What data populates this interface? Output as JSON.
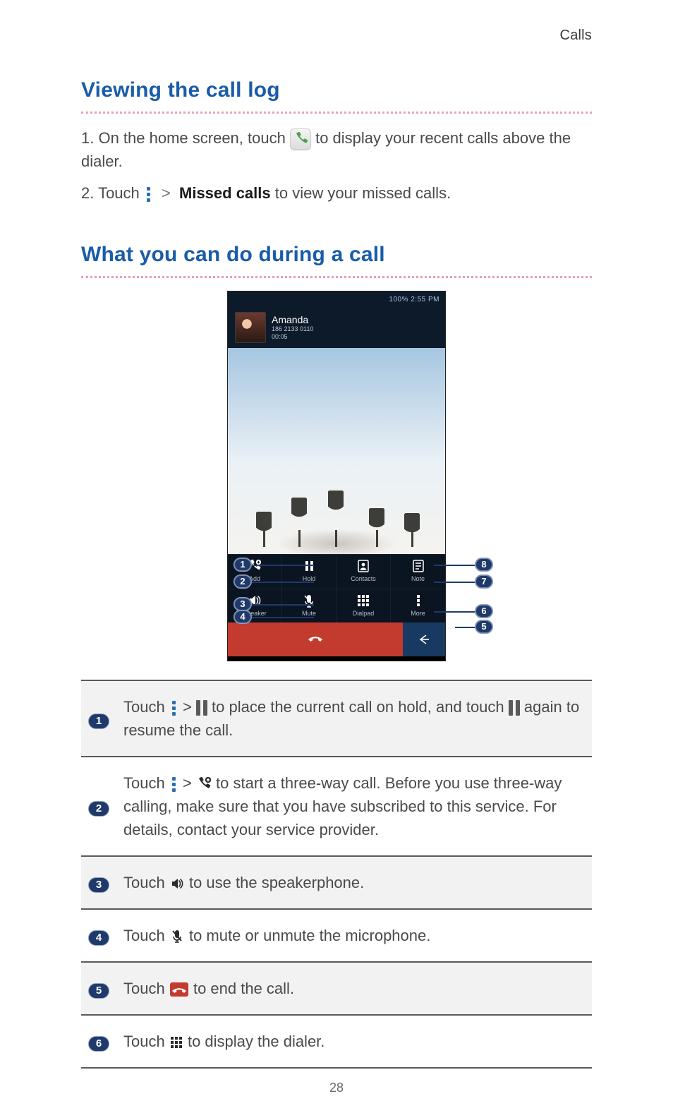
{
  "running_head": "Calls",
  "sections": {
    "viewing": {
      "title": "Viewing the call log",
      "step1_prefix": "1. On the home screen, touch ",
      "step1_suffix": " to display your recent calls above the dialer.",
      "step2_prefix": "2. Touch ",
      "step2_gt": ">",
      "step2_bold": "Missed calls",
      "step2_suffix": " to view your missed calls."
    },
    "during": {
      "title": "What you can do during a call"
    }
  },
  "phone": {
    "status_right": "100%  2:55 PM",
    "caller_name": "Amanda",
    "caller_number": "186 2133 0110",
    "elapsed": "00:05",
    "row1": [
      {
        "icon": "add-call",
        "label": "Add"
      },
      {
        "icon": "hold",
        "label": "Hold"
      },
      {
        "icon": "contacts",
        "label": "Contacts"
      },
      {
        "icon": "note",
        "label": "Note"
      }
    ],
    "row2": [
      {
        "icon": "speaker",
        "label": "Speaker"
      },
      {
        "icon": "mute",
        "label": "Mute"
      },
      {
        "icon": "dialpad",
        "label": "Dialpad"
      },
      {
        "icon": "more",
        "label": "More"
      }
    ]
  },
  "callouts_left": [
    "1",
    "2",
    "3",
    "4"
  ],
  "callouts_right": [
    "8",
    "7",
    "6",
    "5"
  ],
  "table": {
    "rows": [
      {
        "num": "1",
        "alt": true,
        "parts": {
          "p1": "Touch ",
          "gt": " > ",
          "p2": " to place the current call on hold, and touch ",
          "p3": " again to resume the call."
        }
      },
      {
        "num": "2",
        "alt": false,
        "parts": {
          "p1": "Touch ",
          "gt": " > ",
          "p2": " to start a three-way call. Before you use three-way calling, make sure that you have subscribed to this service. For details, contact your service provider."
        }
      },
      {
        "num": "3",
        "alt": true,
        "parts": {
          "p1": "Touch ",
          "p2": " to use the speakerphone."
        }
      },
      {
        "num": "4",
        "alt": false,
        "parts": {
          "p1": "Touch ",
          "p2": " to mute or unmute the microphone."
        }
      },
      {
        "num": "5",
        "alt": true,
        "parts": {
          "p1": "Touch ",
          "p2": " to end the call."
        }
      },
      {
        "num": "6",
        "alt": false,
        "parts": {
          "p1": "Touch ",
          "p2": " to display the dialer."
        }
      }
    ]
  },
  "page_number": "28",
  "chart_data": {
    "type": "table",
    "title": "What you can do during a call — numbered callouts",
    "rows": [
      {
        "num": 1,
        "action": "Touch More > Pause to place the current call on hold, and touch Pause again to resume the call."
      },
      {
        "num": 2,
        "action": "Touch More > Add-call to start a three-way call. Before you use three-way calling, make sure that you have subscribed to this service. For details, contact your service provider."
      },
      {
        "num": 3,
        "action": "Touch Speaker to use the speakerphone."
      },
      {
        "num": 4,
        "action": "Touch Mute to mute or unmute the microphone."
      },
      {
        "num": 5,
        "action": "Touch End-call to end the call."
      },
      {
        "num": 6,
        "action": "Touch Dialpad to display the dialer."
      }
    ]
  }
}
